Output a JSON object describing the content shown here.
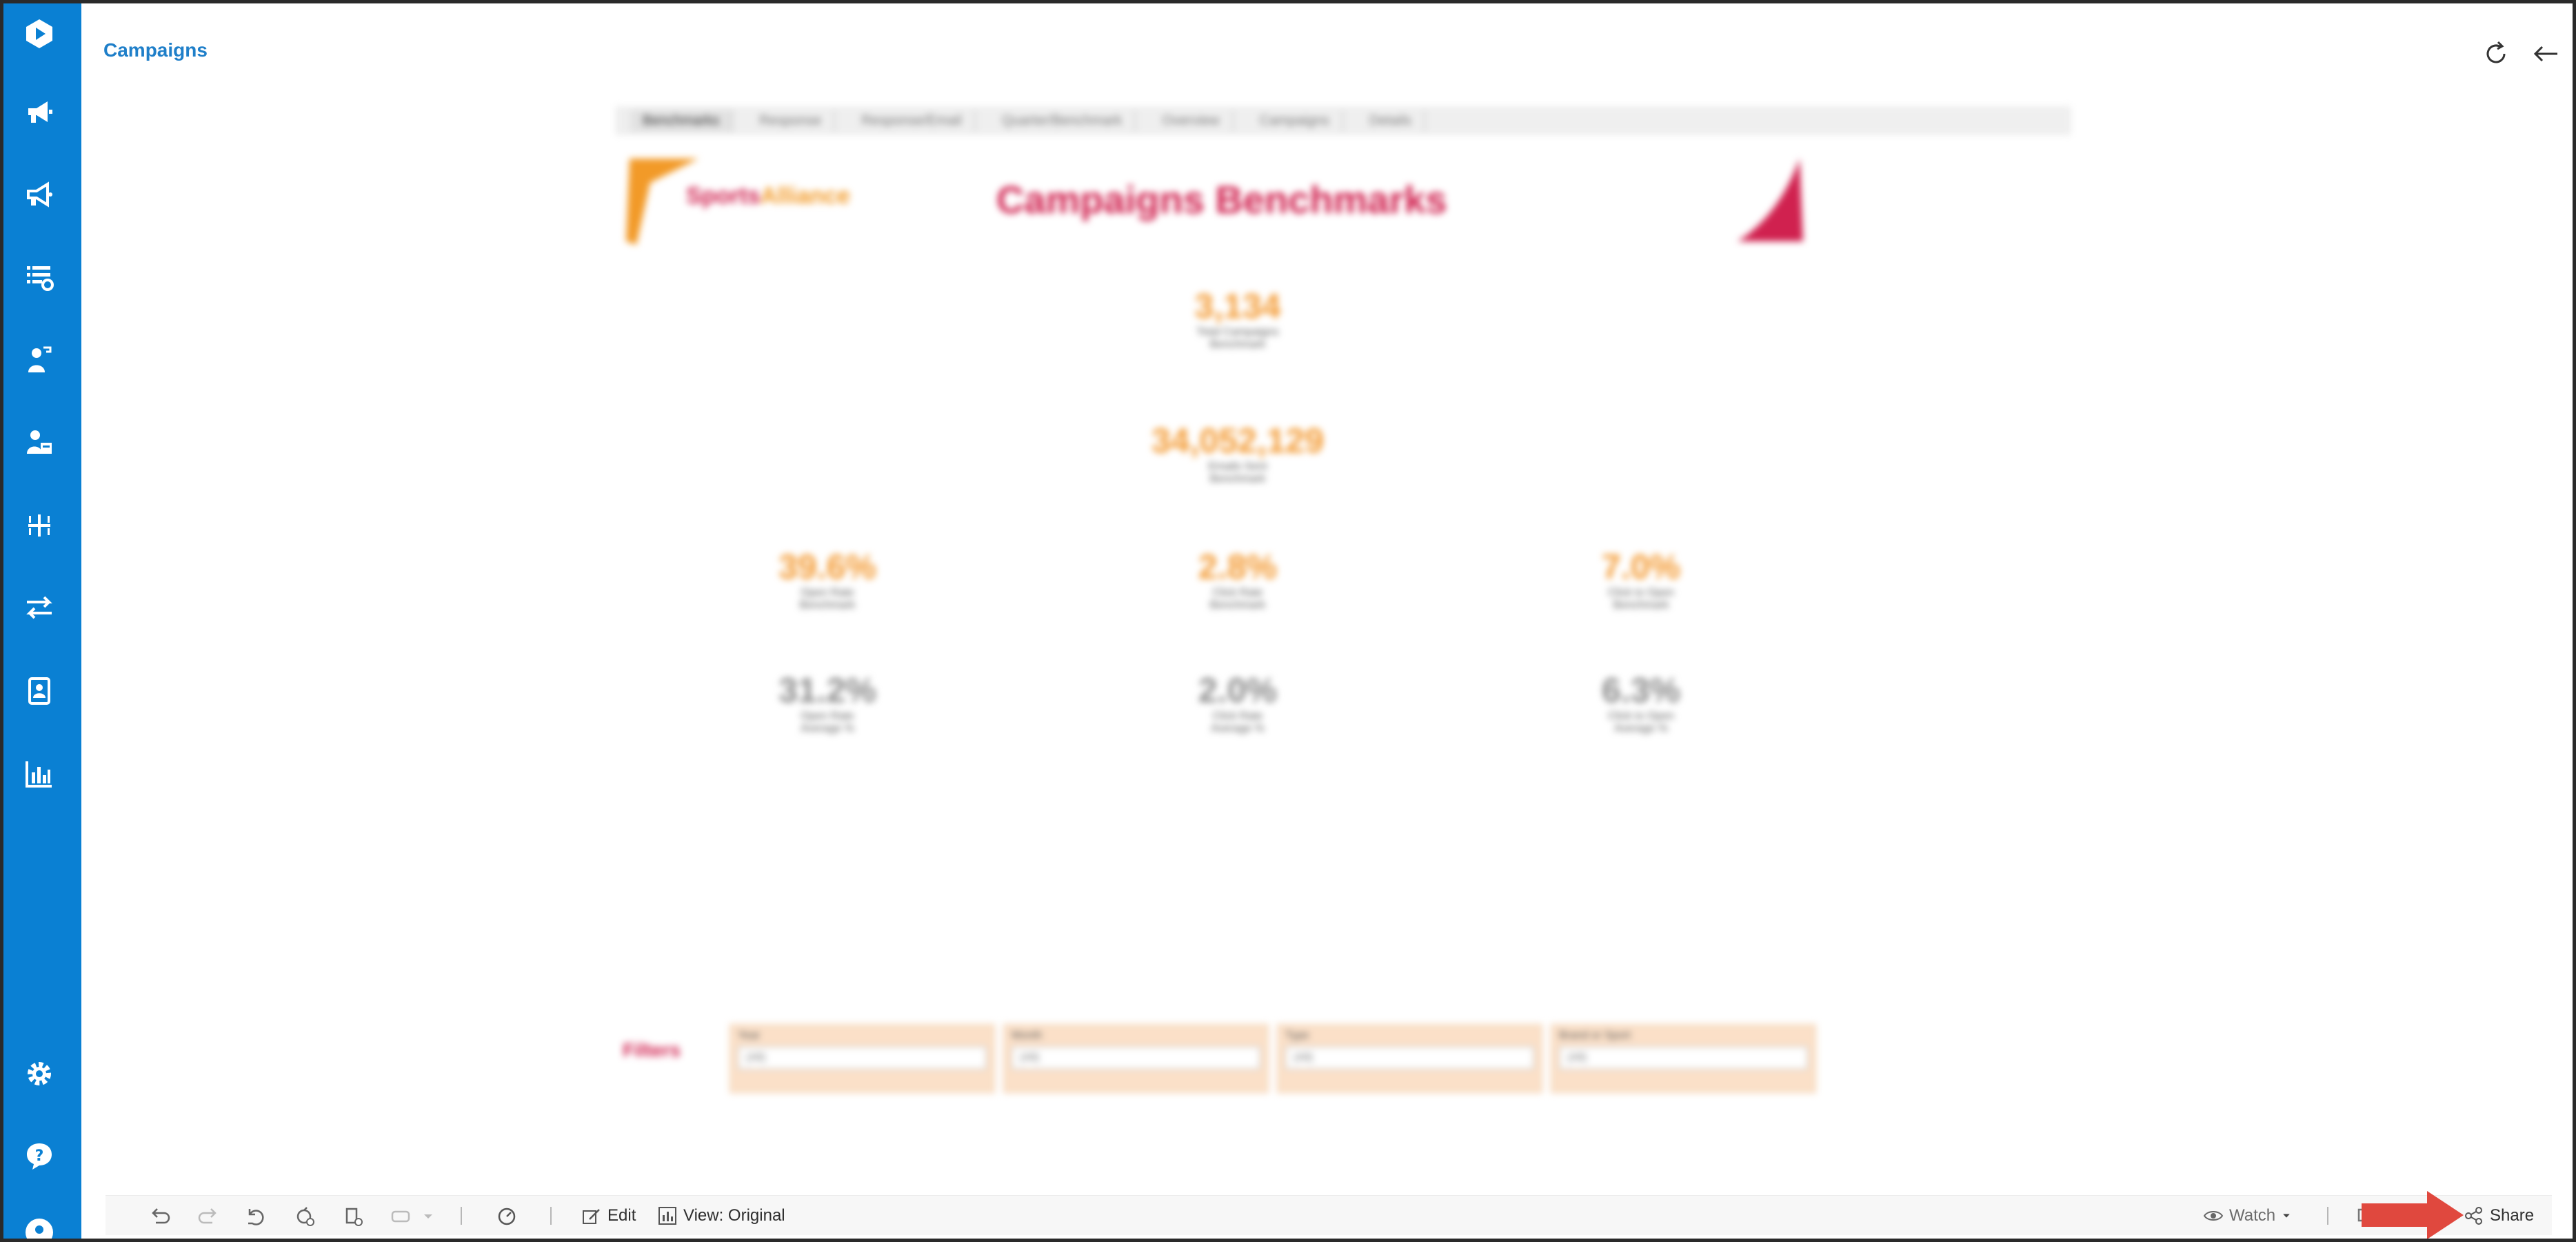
{
  "header": {
    "title": "Campaigns"
  },
  "dashboard": {
    "tabs": [
      "Benchmarks",
      "Response",
      "Response/Email",
      "Quarter/Benchmark",
      "Overview",
      "Campaigns",
      "Details"
    ],
    "brand_part1": "Sports",
    "brand_part2": "Alliance",
    "title": "Campaigns Benchmarks",
    "kpis": [
      {
        "value": "3,134",
        "label1": "Total Campaigns",
        "label2": "Benchmark",
        "tone": "orange"
      },
      {
        "value": "34,052,129",
        "label1": "Emails Sent",
        "label2": "Benchmark",
        "tone": "orange"
      },
      {
        "value": "39.6%",
        "label1": "Open Rate",
        "label2": "Benchmark",
        "tone": "orange"
      },
      {
        "value": "2.8%",
        "label1": "Click Rate",
        "label2": "Benchmark",
        "tone": "orange"
      },
      {
        "value": "7.0%",
        "label1": "Click to Open",
        "label2": "Benchmark",
        "tone": "orange"
      },
      {
        "value": "31.2%",
        "label1": "Open Rate",
        "label2": "Average %",
        "tone": "grey"
      },
      {
        "value": "2.0%",
        "label1": "Click Rate",
        "label2": "Average %",
        "tone": "grey"
      },
      {
        "value": "6.3%",
        "label1": "Click to Open",
        "label2": "Average %",
        "tone": "grey"
      }
    ],
    "filters_label": "Filters",
    "filters": [
      {
        "label": "Year",
        "value": "(All)"
      },
      {
        "label": "Month",
        "value": "(All)"
      },
      {
        "label": "Type",
        "value": "(All)"
      },
      {
        "label": "Brand or Sport",
        "value": "(All)"
      }
    ]
  },
  "toolbar": {
    "edit_label": "Edit",
    "view_label": "View: Original",
    "watch_label": "Watch",
    "share_label": "Share"
  },
  "colors": {
    "sidebar": "#0a80d3",
    "title_blue": "#1f7fc9",
    "brand_pink": "#d0214f",
    "kpi_orange": "#f39a33",
    "annotation_red": "#e0483e"
  }
}
